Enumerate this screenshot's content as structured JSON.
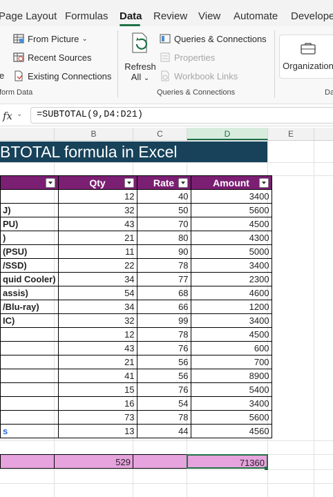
{
  "ribbon_tabs": [
    "Page Layout",
    "Formulas",
    "Data",
    "Review",
    "View",
    "Automate",
    "Developer"
  ],
  "active_tab": "Data",
  "ribbon": {
    "get_transform": {
      "from_picture": "From Picture",
      "recent_sources": "Recent Sources",
      "existing_connections": "Existing Connections",
      "label": "form Data",
      "cut_letter": "e"
    },
    "queries": {
      "refresh_label": "Refresh",
      "refresh_all": "All",
      "queries_connections": "Queries & Connections",
      "properties": "Properties",
      "workbook_links": "Workbook Links",
      "label": "Queries & Connections"
    },
    "organization_label": "Organization",
    "cut_group_label": "Da"
  },
  "formula_bar": {
    "fx": "fx",
    "formula": "=SUBTOTAL(9,D4:D21)"
  },
  "columns": [
    "B",
    "C",
    "D",
    "E"
  ],
  "selected_column": "D",
  "banner_title": "BTOTAL formula in Excel",
  "table": {
    "headers": [
      "Qty",
      "Rate",
      "Amount"
    ],
    "rows": [
      {
        "name": "",
        "qty": "12",
        "rate": "40",
        "amount": "3400"
      },
      {
        "name": "J)",
        "qty": "32",
        "rate": "50",
        "amount": "5600"
      },
      {
        "name": "PU)",
        "qty": "43",
        "rate": "70",
        "amount": "4500"
      },
      {
        "name": ")",
        "qty": "21",
        "rate": "80",
        "amount": "4300"
      },
      {
        "name": "(PSU)",
        "qty": "11",
        "rate": "90",
        "amount": "5000"
      },
      {
        "name": "/SSD)",
        "qty": "22",
        "rate": "78",
        "amount": "3400"
      },
      {
        "name": "quid Cooler)",
        "qty": "34",
        "rate": "77",
        "amount": "2300"
      },
      {
        "name": "assis)",
        "qty": "54",
        "rate": "68",
        "amount": "4600"
      },
      {
        "name": "/Blu-ray)",
        "qty": "34",
        "rate": "66",
        "amount": "1200"
      },
      {
        "name": "IC)",
        "qty": "32",
        "rate": "99",
        "amount": "3400"
      },
      {
        "name": "",
        "qty": "12",
        "rate": "78",
        "amount": "4500"
      },
      {
        "name": "",
        "qty": "43",
        "rate": "76",
        "amount": "600"
      },
      {
        "name": "",
        "qty": "21",
        "rate": "56",
        "amount": "700"
      },
      {
        "name": "",
        "qty": "41",
        "rate": "56",
        "amount": "8900"
      },
      {
        "name": "",
        "qty": "15",
        "rate": "76",
        "amount": "5400"
      },
      {
        "name": "",
        "qty": "16",
        "rate": "54",
        "amount": "3400"
      },
      {
        "name": "",
        "qty": "73",
        "rate": "78",
        "amount": "5600"
      },
      {
        "name": "s",
        "qty": "13",
        "rate": "44",
        "amount": "4560"
      }
    ]
  },
  "totals": {
    "qty": "529",
    "amount": "71360"
  },
  "colors": {
    "header_purple": "#7b1f73",
    "banner_navy": "#17425a",
    "total_pink": "#e6a3dd",
    "excel_green": "#1e7145"
  }
}
